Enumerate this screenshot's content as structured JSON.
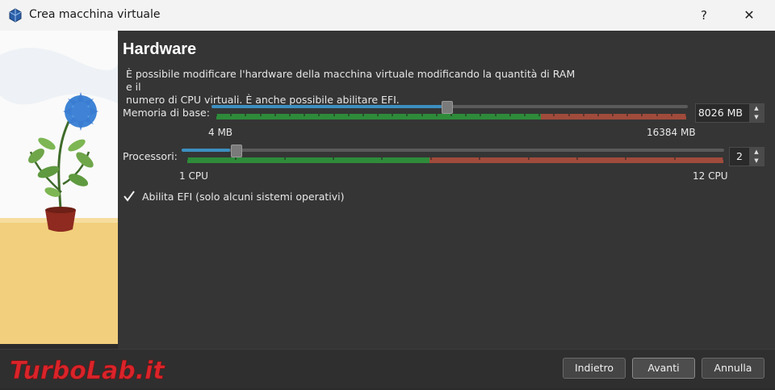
{
  "window": {
    "title": "Crea macchina virtuale",
    "help_label": "?",
    "close_label": "✕"
  },
  "page": {
    "title": "Hardware",
    "description_line1": "È possibile modificare l'hardware della macchina virtuale modificando la quantità di RAM e il",
    "description_line2": "numero di CPU virtuali. È anche possibile abilitare EFI."
  },
  "memory": {
    "label": "Memoria di base:",
    "min_label": "4 MB",
    "max_label": "16384 MB",
    "value_text": "8026 MB",
    "value": 8026,
    "min": 4,
    "max": 16384
  },
  "cpu": {
    "label": "Processori:",
    "min_label": "1 CPU",
    "max_label": "12 CPU",
    "value_text": "2",
    "value": 2,
    "min": 1,
    "max": 12
  },
  "efi": {
    "label": "Abilita EFI (solo alcuni sistemi operativi)",
    "checked": true
  },
  "buttons": {
    "back": "Indietro",
    "next": "Avanti",
    "cancel": "Annulla"
  },
  "watermark": {
    "text": "TurboLab.it"
  },
  "colors": {
    "slider_fill": "#3c8fc0",
    "ok_zone": "#2e8b3a",
    "warn_zone": "#a04b3b",
    "watermark": "#d9242a"
  }
}
